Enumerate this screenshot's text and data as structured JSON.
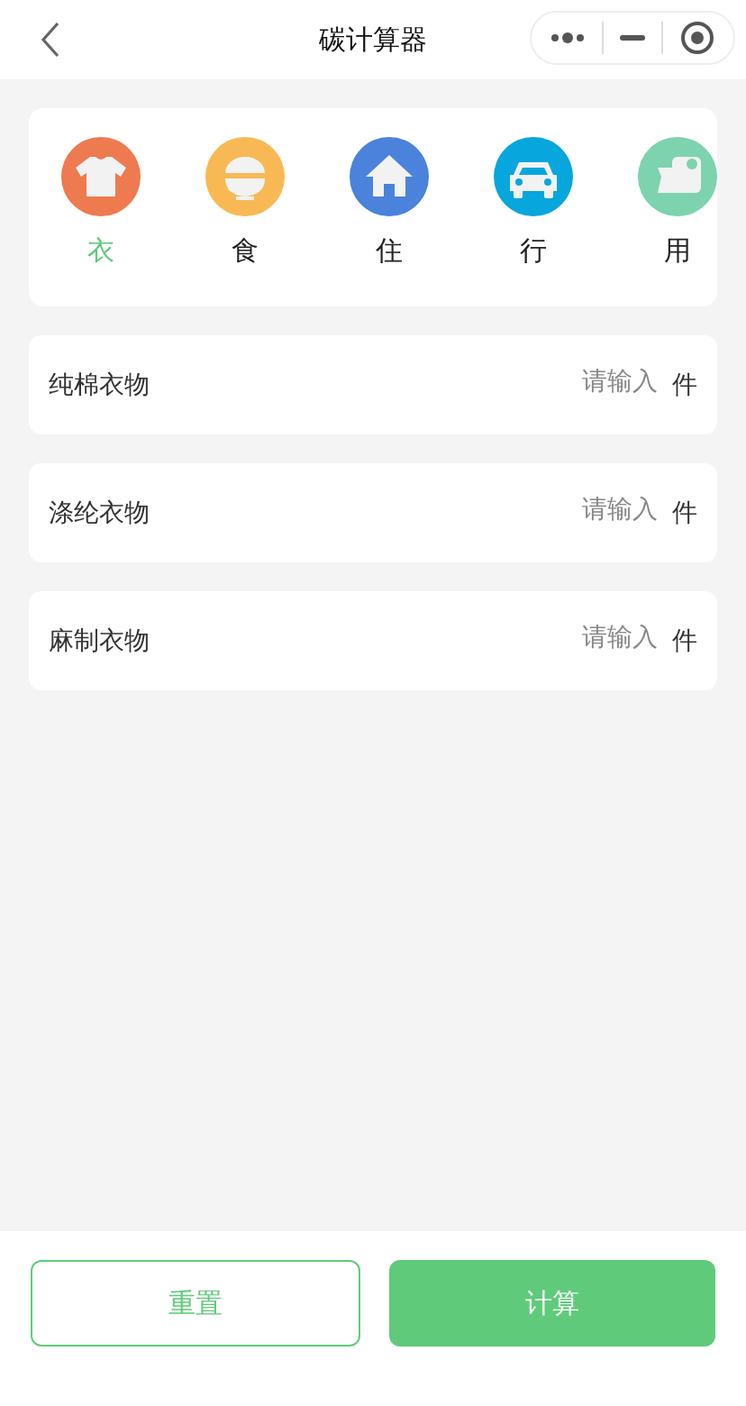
{
  "header": {
    "title": "碳计算器"
  },
  "categories": [
    {
      "label": "衣",
      "kind": "shirt",
      "color": "#ee7a50",
      "selected": true
    },
    {
      "label": "食",
      "kind": "bowl",
      "color": "#f8b955",
      "selected": false
    },
    {
      "label": "住",
      "kind": "house",
      "color": "#4a82dc",
      "selected": false
    },
    {
      "label": "行",
      "kind": "car",
      "color": "#07a6dc",
      "selected": false
    },
    {
      "label": "用",
      "kind": "roll",
      "color": "#7dd3ae",
      "selected": false
    }
  ],
  "fields": [
    {
      "label": "纯棉衣物",
      "placeholder": "请输入",
      "unit": "件"
    },
    {
      "label": "涤纶衣物",
      "placeholder": "请输入",
      "unit": "件"
    },
    {
      "label": "麻制衣物",
      "placeholder": "请输入",
      "unit": "件"
    }
  ],
  "buttons": {
    "reset": "重置",
    "calculate": "计算"
  }
}
